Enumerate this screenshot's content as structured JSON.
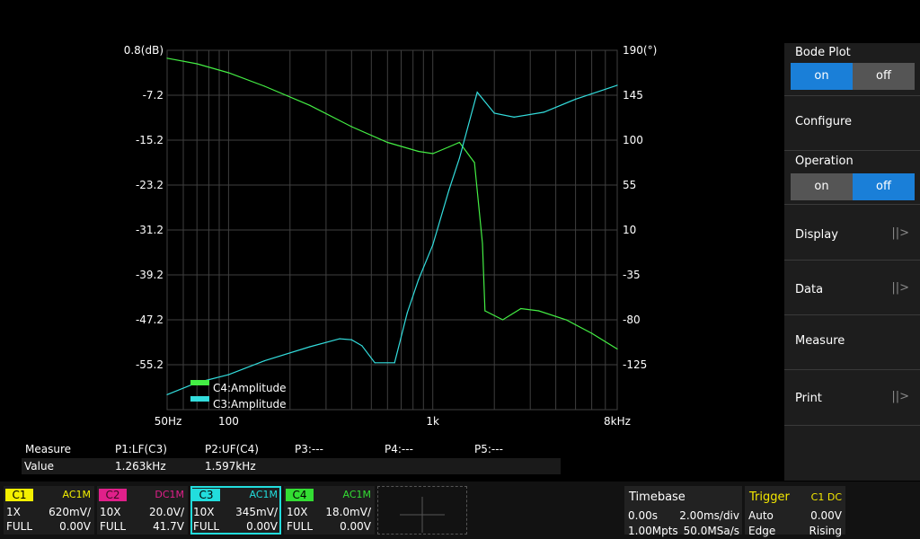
{
  "bode": {
    "y_left_labels": [
      "0.8(dB)",
      "-7.2",
      "-15.2",
      "-23.2",
      "-31.2",
      "-39.2",
      "-47.2",
      "-55.2"
    ],
    "y_right_labels": [
      "190(°)",
      "145",
      "100",
      "55",
      "10",
      "-35",
      "-80",
      "-125"
    ],
    "x_labels": [
      "50Hz",
      "100",
      "1k",
      "8kHz"
    ],
    "legend": [
      "C4:Amplitude",
      "C3:Amplitude"
    ],
    "colors": {
      "green": "#44ee44",
      "cyan": "#33dddd",
      "grid": "#3f3f3f"
    }
  },
  "chart_data": {
    "type": "line",
    "x_scale": "log",
    "xlim": [
      50,
      8000
    ],
    "ylim_left": [
      -63.2,
      0.8
    ],
    "ylim_right": [
      -170,
      190
    ],
    "grid": true,
    "legend_position": "bottom-left",
    "series": [
      {
        "name": "C4:Amplitude",
        "color": "#44ee44",
        "points": [
          [
            50,
            -0.6
          ],
          [
            70,
            -1.6
          ],
          [
            100,
            -3.2
          ],
          [
            150,
            -5.6
          ],
          [
            250,
            -9.0
          ],
          [
            400,
            -12.8
          ],
          [
            600,
            -15.6
          ],
          [
            850,
            -17.2
          ],
          [
            1000,
            -17.6
          ],
          [
            1200,
            -16.4
          ],
          [
            1350,
            -15.6
          ],
          [
            1600,
            -19.2
          ],
          [
            1750,
            -33.6
          ],
          [
            1800,
            -45.6
          ],
          [
            2200,
            -47.2
          ],
          [
            2700,
            -45.2
          ],
          [
            3300,
            -45.6
          ],
          [
            4500,
            -47.2
          ],
          [
            6000,
            -49.6
          ],
          [
            8000,
            -52.4
          ]
        ]
      },
      {
        "name": "C3:Amplitude",
        "color": "#33dddd",
        "points": [
          [
            50,
            -155
          ],
          [
            70,
            -143
          ],
          [
            100,
            -135
          ],
          [
            150,
            -121
          ],
          [
            250,
            -107
          ],
          [
            350,
            -99
          ],
          [
            400,
            -100
          ],
          [
            450,
            -106
          ],
          [
            520,
            -123
          ],
          [
            650,
            -123
          ],
          [
            750,
            -73
          ],
          [
            850,
            -40
          ],
          [
            1000,
            -5
          ],
          [
            1200,
            50
          ],
          [
            1350,
            82
          ],
          [
            1650,
            148
          ],
          [
            2000,
            127
          ],
          [
            2500,
            123
          ],
          [
            3500,
            128
          ],
          [
            5000,
            141
          ],
          [
            8000,
            155
          ]
        ]
      }
    ]
  },
  "right_menu": {
    "bode_plot": {
      "label": "Bode Plot",
      "on": "on",
      "off": "off"
    },
    "configure": "Configure",
    "operation": {
      "label": "Operation",
      "on": "on",
      "off": "off"
    },
    "display": "Display",
    "data": "Data",
    "measure": "Measure",
    "print": "Print"
  },
  "measure": {
    "headers": [
      "Measure",
      "P1:LF(C3)",
      "P2:UF(C4)",
      "P3:---",
      "P4:---",
      "P5:---"
    ],
    "values": [
      "Value",
      "1.263kHz",
      "1.597kHz"
    ]
  },
  "channels": [
    {
      "name": "C1",
      "coupling": "AC1M",
      "probe": "1X",
      "scale": "620mV/",
      "range": "FULL",
      "offset": "0.00V",
      "color": "#f4f000"
    },
    {
      "name": "C2",
      "coupling": "DC1M",
      "probe": "10X",
      "scale": "20.0V/",
      "range": "FULL",
      "offset": "41.7V",
      "color": "#e0208a"
    },
    {
      "name": "C3",
      "coupling": "AC1M",
      "probe": "10X",
      "scale": "345mV/",
      "range": "FULL",
      "offset": "0.00V",
      "color": "#22dddd"
    },
    {
      "name": "C4",
      "coupling": "AC1M",
      "probe": "10X",
      "scale": "18.0mV/",
      "range": "FULL",
      "offset": "0.00V",
      "color": "#33dd33"
    }
  ],
  "timebase": {
    "title": "Timebase",
    "delay": "0.00s",
    "scale": "2.00ms/div",
    "points": "1.00Mpts",
    "rate": "50.0MSa/s"
  },
  "trigger": {
    "title": "Trigger",
    "source": "C1 DC",
    "mode": "Auto",
    "level": "0.00V",
    "type": "Edge",
    "slope": "Rising"
  }
}
